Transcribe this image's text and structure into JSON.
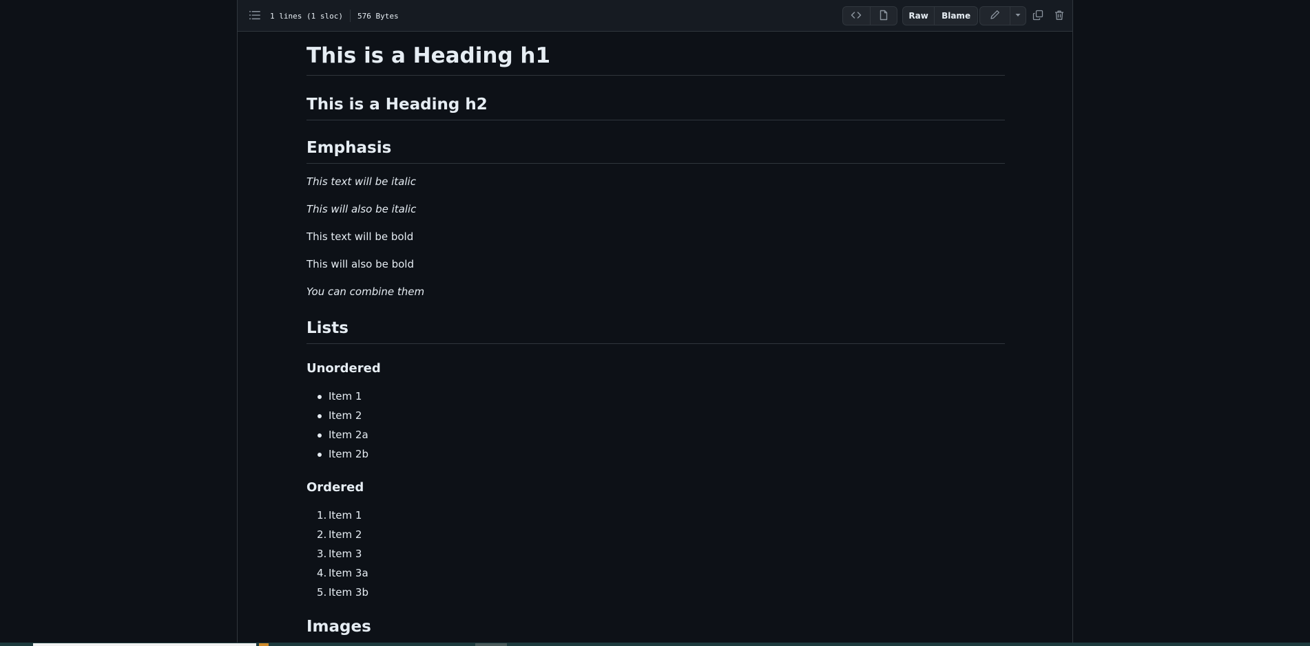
{
  "file_header": {
    "lines_info": "1 lines (1 sloc)",
    "size_info": "576 Bytes",
    "raw_label": "Raw",
    "blame_label": "Blame"
  },
  "icons": {
    "toc": "list-unordered-icon",
    "code": "code-icon",
    "preview": "file-icon",
    "edit": "pencil-icon",
    "dropdown": "triangle-down-icon",
    "copy": "copy-icon",
    "delete": "trash-icon"
  },
  "colors": {
    "background": "#0d1117",
    "header_bg": "#161b22",
    "border": "#30363d",
    "text": "#e6edf3",
    "button_bg": "#21262d"
  },
  "markdown": {
    "h1": "This is a Heading h1",
    "h2": "This is a Heading h2",
    "emphasis_heading": "Emphasis",
    "emphasis_items": [
      "This text will be italic",
      "This will also be italic",
      "This text will be bold",
      "This will also be bold",
      "You can combine them"
    ],
    "lists_heading": "Lists",
    "unordered_heading": "Unordered",
    "unordered_items": [
      "Item 1",
      "Item 2",
      "Item 2a",
      "Item 2b"
    ],
    "ordered_heading": "Ordered",
    "ordered_items": [
      {
        "num": "1.",
        "label": "Item 1"
      },
      {
        "num": "2.",
        "label": "Item 2"
      },
      {
        "num": "3.",
        "label": "Item 3"
      },
      {
        "num": "4.",
        "label": "Item 3a"
      },
      {
        "num": "5.",
        "label": "Item 3b"
      }
    ],
    "images_heading": "Images"
  }
}
